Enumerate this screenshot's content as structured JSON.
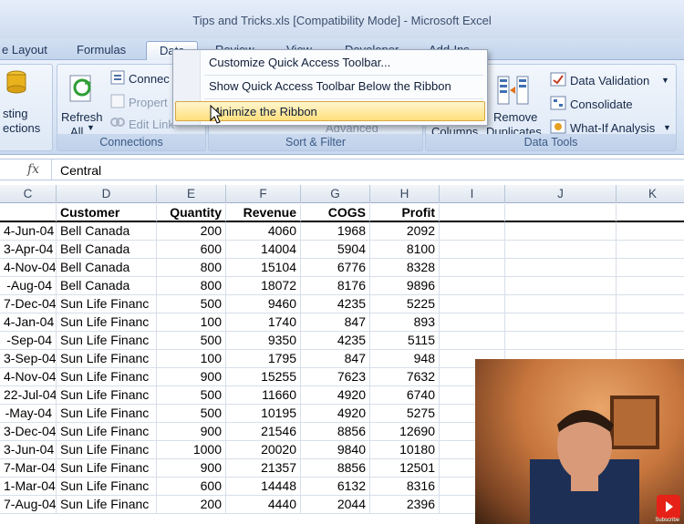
{
  "window": {
    "title": "Tips and Tricks.xls  [Compatibility Mode] - Microsoft Excel"
  },
  "tabs": [
    "e Layout",
    "Formulas",
    "Data",
    "Review",
    "View",
    "Developer",
    "Add-Ins"
  ],
  "ribbon": {
    "existing_label_1": "sting",
    "existing_label_2": "ections",
    "refresh_label_1": "Refresh",
    "refresh_label_2": "All",
    "connections_label": "Connec",
    "properties_label": "Propert",
    "edit_links_label": "Edit Link",
    "connections_group": "Connections",
    "sort_filter_group": "Sort & Filter",
    "advanced_label": "Advanced",
    "columns_label": "Columns",
    "remove_label": "Remove",
    "duplicates_label": "Duplicates",
    "data_validation_label": "Data Validation",
    "consolidate_label": "Consolidate",
    "whatif_label": "What-If Analysis",
    "data_tools_group": "Data Tools"
  },
  "context_menu": {
    "items": [
      "Customize Quick Access Toolbar...",
      "Show Quick Access Toolbar Below the Ribbon",
      "Minimize the Ribbon"
    ],
    "highlighted": "Minimize the Ribbon"
  },
  "formula_bar": {
    "fx": "fx",
    "value": "Central"
  },
  "columns": [
    "C",
    "D",
    "E",
    "F",
    "G",
    "H",
    "I",
    "J",
    "K"
  ],
  "table": {
    "headers": [
      "",
      "Customer",
      "Quantity",
      "Revenue",
      "COGS",
      "Profit"
    ],
    "rows": [
      [
        "4-Jun-04",
        "Bell Canada",
        "200",
        "4060",
        "1968",
        "2092"
      ],
      [
        "3-Apr-04",
        "Bell Canada",
        "600",
        "14004",
        "5904",
        "8100"
      ],
      [
        "4-Nov-04",
        "Bell Canada",
        "800",
        "15104",
        "6776",
        "8328"
      ],
      [
        "-Aug-04",
        "Bell Canada",
        "800",
        "18072",
        "8176",
        "9896"
      ],
      [
        "7-Dec-04",
        "Sun Life Financ",
        "500",
        "9460",
        "4235",
        "5225"
      ],
      [
        "4-Jan-04",
        "Sun Life Financ",
        "100",
        "1740",
        "847",
        "893"
      ],
      [
        "-Sep-04",
        "Sun Life Financ",
        "500",
        "9350",
        "4235",
        "5115"
      ],
      [
        "3-Sep-04",
        "Sun Life Financ",
        "100",
        "1795",
        "847",
        "948"
      ],
      [
        "4-Nov-04",
        "Sun Life Financ",
        "900",
        "15255",
        "7623",
        "7632"
      ],
      [
        "22-Jul-04",
        "Sun Life Financ",
        "500",
        "11660",
        "4920",
        "6740"
      ],
      [
        "-May-04",
        "Sun Life Financ",
        "500",
        "10195",
        "4920",
        "5275"
      ],
      [
        "3-Dec-04",
        "Sun Life Financ",
        "900",
        "21546",
        "8856",
        "12690"
      ],
      [
        "3-Jun-04",
        "Sun Life Financ",
        "1000",
        "20020",
        "9840",
        "10180"
      ],
      [
        "7-Mar-04",
        "Sun Life Financ",
        "900",
        "21357",
        "8856",
        "12501"
      ],
      [
        "1-Mar-04",
        "Sun Life Financ",
        "600",
        "14448",
        "6132",
        "8316"
      ],
      [
        "7-Aug-04",
        "Sun Life Financ",
        "200",
        "4440",
        "2044",
        "2396"
      ]
    ]
  },
  "webcam": {
    "badge": "Subscribe"
  }
}
